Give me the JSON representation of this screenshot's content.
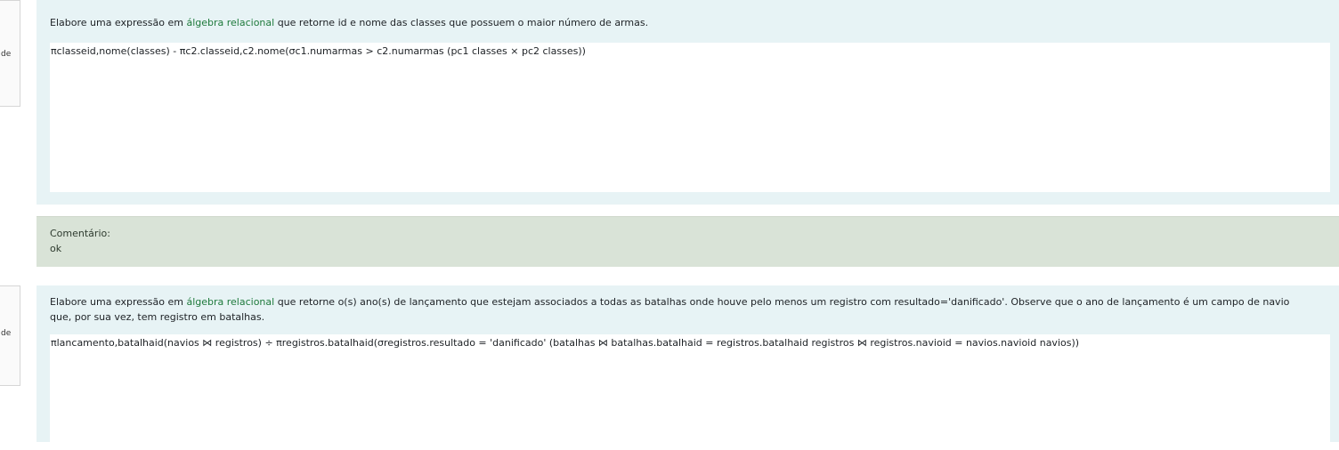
{
  "questions": [
    {
      "info_partial": "de",
      "text_before": "Elabore uma expressão em ",
      "text_link": "álgebra relacional",
      "text_after": " que retorne id e nome das classes que possuem o maior número de armas.",
      "answer": "πclasseid,nome(classes) - πc2.classeid,c2.nome(σc1.numarmas > c2.numarmas (pc1 classes × pc2 classes))"
    },
    {
      "info_partial": "de",
      "text_before": "Elabore uma expressão em ",
      "text_link": "álgebra relacional",
      "text_after": " que retorne o(s) ano(s) de lançamento que estejam associados a todas as batalhas onde houve pelo menos um registro com resultado='danificado'. Observe que o ano de lançamento é um campo de navio que, por sua vez, tem registro em batalhas.",
      "answer": "πlancamento,batalhaid(navios ⋈ registros) ÷ πregistros.batalhaid(σregistros.resultado = 'danificado' (batalhas ⋈ batalhas.batalhaid = registros.batalhaid registros ⋈ registros.navioid = navios.navioid navios))"
    }
  ],
  "comment": {
    "label": "Comentário:",
    "text": "ok"
  },
  "colors": {
    "question_bg": "#e7f3f5",
    "comment_bg": "#d9e3d7",
    "link_green": "#1f7a3c"
  }
}
